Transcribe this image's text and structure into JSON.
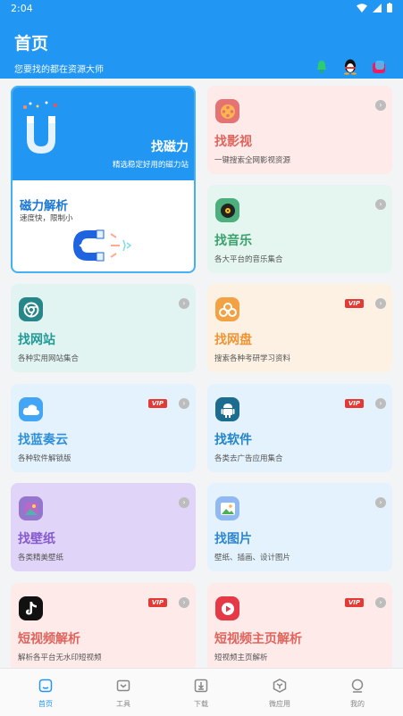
{
  "status": {
    "time": "2:04"
  },
  "header": {
    "title": "首页",
    "subtitle": "您要找的都在资源大师"
  },
  "magnet_card": {
    "title": "找磁力",
    "subtitle": "精选稳定好用的磁力站",
    "parse_title": "磁力解析",
    "parse_subtitle": "速度快，限制小"
  },
  "cards": [
    {
      "title": "找影视",
      "desc": "一键搜索全网影视资源",
      "vip": ""
    },
    {
      "title": "找音乐",
      "desc": "各大平台的音乐集合",
      "vip": ""
    },
    {
      "title": "找网站",
      "desc": "各种实用网站集合",
      "vip": ""
    },
    {
      "title": "找网盘",
      "desc": "搜索各种考研学习资料",
      "vip": "VIP"
    },
    {
      "title": "找蓝奏云",
      "desc": "各种软件解锁版",
      "vip": "VIP"
    },
    {
      "title": "找软件",
      "desc": "各类去广告应用集合",
      "vip": "VIP"
    },
    {
      "title": "找壁纸",
      "desc": "各类精美壁纸",
      "vip": ""
    },
    {
      "title": "找图片",
      "desc": "壁纸、插画、设计图片",
      "vip": ""
    },
    {
      "title": "短视频解析",
      "desc": "解析各平台无水印短视频",
      "vip": "VIP"
    },
    {
      "title": "短视频主页解析",
      "desc": "短视频主页解析",
      "vip": "VIP"
    }
  ],
  "nav": [
    {
      "label": "首页"
    },
    {
      "label": "工具"
    },
    {
      "label": "下载"
    },
    {
      "label": "微应用"
    },
    {
      "label": "我的"
    }
  ],
  "colors": {
    "primary": "#2196f3"
  }
}
